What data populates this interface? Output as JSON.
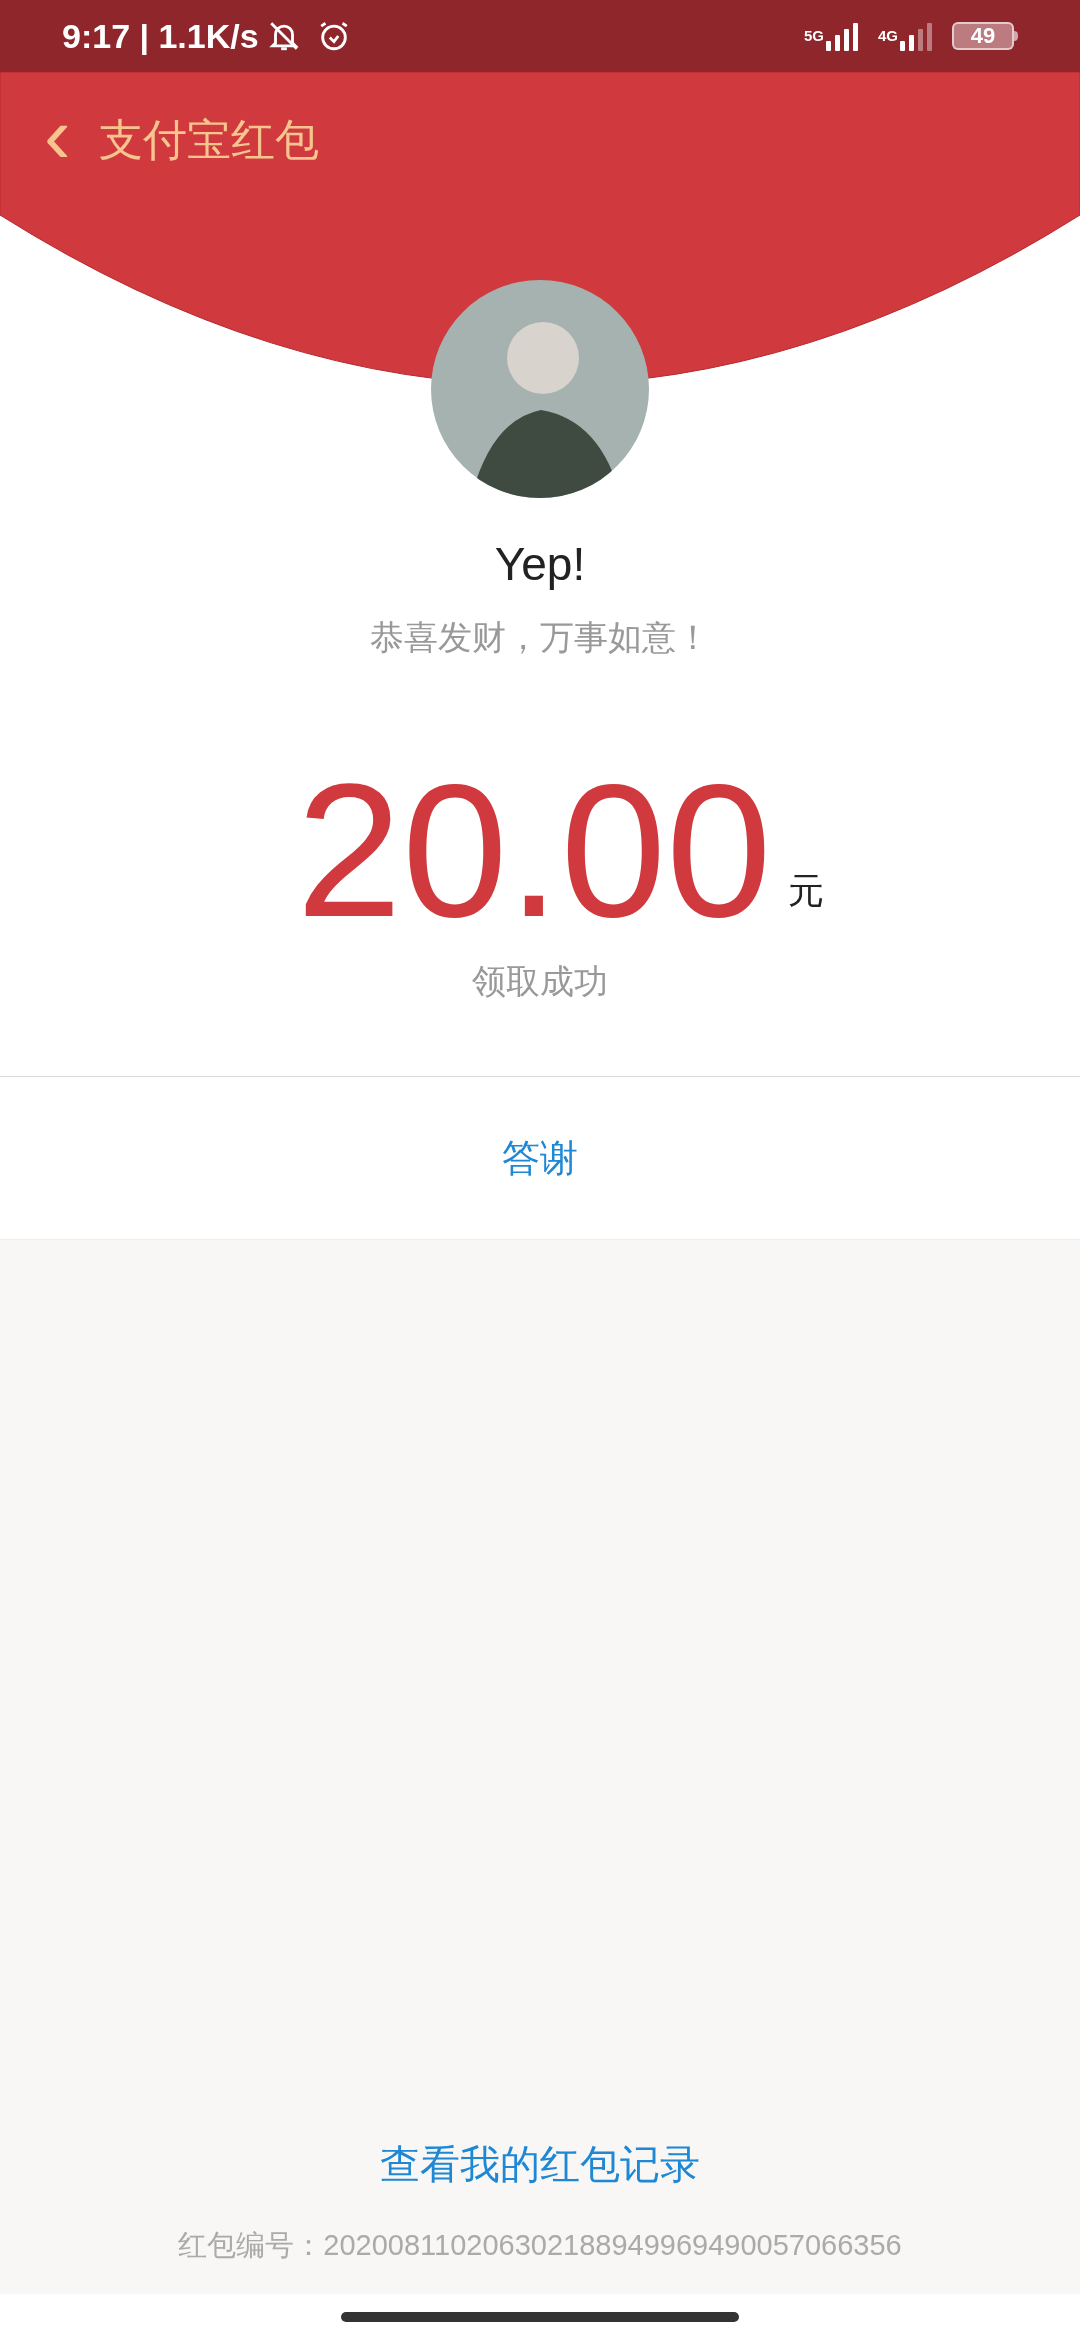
{
  "status_bar": {
    "clock": "9:17 | 1.1K/s",
    "network_1": "5G",
    "network_2": "4G",
    "battery": "49"
  },
  "header": {
    "back_icon": "‹",
    "title": "支付宝红包"
  },
  "sender": {
    "name": "Yep!",
    "greeting": "恭喜发财，万事如意！"
  },
  "amount": {
    "value": "20.00",
    "unit": "元",
    "status": "领取成功"
  },
  "thank_button": "答谢",
  "footer": {
    "records_link": "查看我的红包记录",
    "serial": "红包编号：202008110206302188949969490057066356"
  }
}
